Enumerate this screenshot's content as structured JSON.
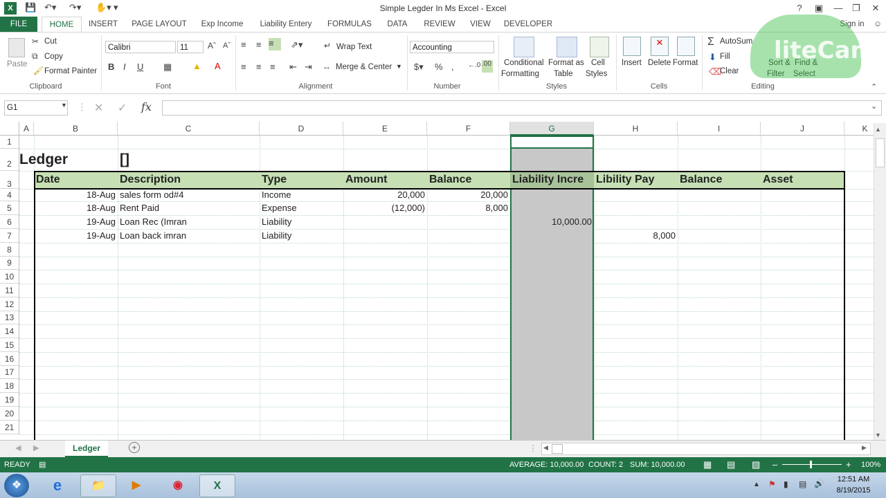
{
  "window": {
    "title": "Simple Legder In Ms Excel - Excel",
    "sign_in": "Sign in"
  },
  "ribbon_tabs": [
    "FILE",
    "HOME",
    "INSERT",
    "PAGE LAYOUT",
    "Exp Income",
    "Liability Entery",
    "FORMULAS",
    "DATA",
    "REVIEW",
    "VIEW",
    "DEVELOPER"
  ],
  "clipboard": {
    "paste": "Paste",
    "cut": "Cut",
    "copy": "Copy",
    "format_painter": "Format Painter",
    "label": "Clipboard"
  },
  "font": {
    "name": "Calibri",
    "size": "11",
    "label": "Font"
  },
  "alignment": {
    "wrap_text": "Wrap Text",
    "merge_center": "Merge & Center",
    "label": "Alignment"
  },
  "number": {
    "format": "Accounting",
    "label": "Number"
  },
  "styles": {
    "conditional": "Conditional",
    "conditional2": "Formatting",
    "format_as": "Format as",
    "format_as2": "Table",
    "cell": "Cell",
    "cell2": "Styles",
    "label": "Styles"
  },
  "cells": {
    "insert": "Insert",
    "delete": "Delete",
    "format": "Format",
    "label": "Cells"
  },
  "editing": {
    "autosum": "AutoSum",
    "fill": "Fill",
    "clear": "Clear",
    "sort": "Sort &",
    "sort2": "Filter",
    "find": "Find &",
    "find2": "Select",
    "label": "Editing"
  },
  "watermark": "liteCam",
  "formula_bar": {
    "name_box": "G1",
    "formula": ""
  },
  "columns": [
    "A",
    "B",
    "C",
    "D",
    "E",
    "F",
    "G",
    "H",
    "I",
    "J",
    "K"
  ],
  "rows": [
    "1",
    "2",
    "3",
    "4",
    "5",
    "6",
    "7",
    "8",
    "9",
    "10",
    "11",
    "12",
    "13",
    "14",
    "15",
    "16",
    "17",
    "18",
    "19",
    "20",
    "21"
  ],
  "sheet": {
    "b2": "Ledger",
    "c2": "[]",
    "headers": [
      "Date",
      "Description",
      "Type",
      "Amount",
      "Balance",
      "Liability Incre",
      "Libility Pay",
      "Balance",
      "Asset"
    ],
    "r4": {
      "date": "18-Aug",
      "desc": "sales form od#4",
      "type": "Income",
      "amount": "20,000",
      "balance": "20,000"
    },
    "r5": {
      "date": "18-Aug",
      "desc": "Rent Paid",
      "type": "Expense",
      "amount": "(12,000)",
      "balance": "8,000"
    },
    "r6": {
      "date": "19-Aug",
      "desc": "Loan Rec (Imran",
      "type": "Liability",
      "liab": "10,000.00"
    },
    "r7": {
      "date": "19-Aug",
      "desc": "Loan back imran",
      "type": "Liability",
      "pay": "8,000"
    }
  },
  "sheet_tab": "Ledger",
  "status": {
    "ready": "READY",
    "average": "AVERAGE: 10,000.00",
    "count": "COUNT: 2",
    "sum": "SUM: 10,000.00",
    "zoom": "100%"
  },
  "clock": {
    "time": "12:51 AM",
    "date": "8/19/2015"
  },
  "colors": {
    "accent": "#217346",
    "header_fill": "#c6e0b4",
    "selection": "#c8c8c8"
  }
}
